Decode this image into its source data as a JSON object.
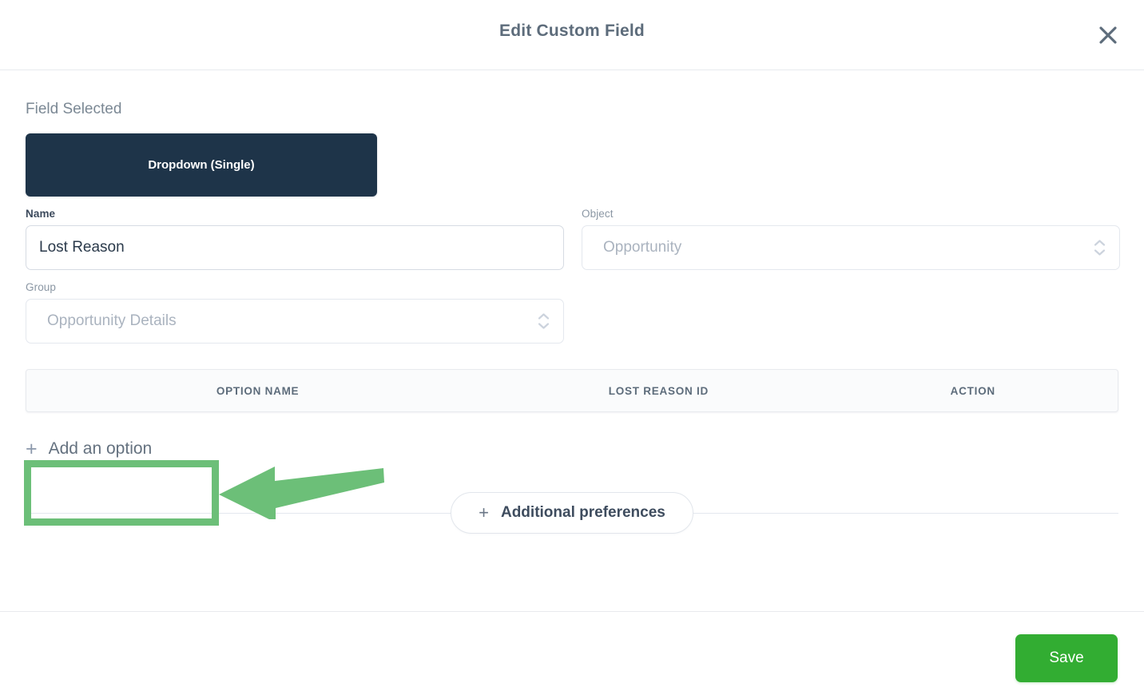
{
  "header": {
    "title": "Edit Custom Field",
    "close_icon": "close-icon"
  },
  "body": {
    "field_selected_label": "Field Selected",
    "field_selected_value": "Dropdown (Single)",
    "fields": {
      "name": {
        "label": "Name",
        "value": "Lost Reason",
        "placeholder": "Name"
      },
      "object": {
        "label": "Object",
        "value": "Opportunity",
        "icon": "chevron-up-down-icon"
      },
      "group": {
        "label": "Group",
        "value": "Opportunity Details",
        "icon": "chevron-up-down-icon"
      }
    },
    "options_table": {
      "columns": [
        "OPTION NAME",
        "LOST REASON ID",
        "ACTION"
      ],
      "rows": [],
      "add_option": {
        "plus": "+",
        "label": "Add an option"
      }
    },
    "additional_preferences": {
      "plus": "+",
      "label": "Additional preferences"
    }
  },
  "footer": {
    "save_label": "Save"
  },
  "annotations": {
    "highlight_color": "#6cbf78",
    "arrow_color": "#6cbf78",
    "target": "add-an-option-button"
  },
  "colors": {
    "accent_navy": "#1e3449",
    "save_green": "#32ad32",
    "annotation_green": "#6cbf78",
    "text_slate": "#5d6c7b",
    "border": "#e8eaee"
  }
}
